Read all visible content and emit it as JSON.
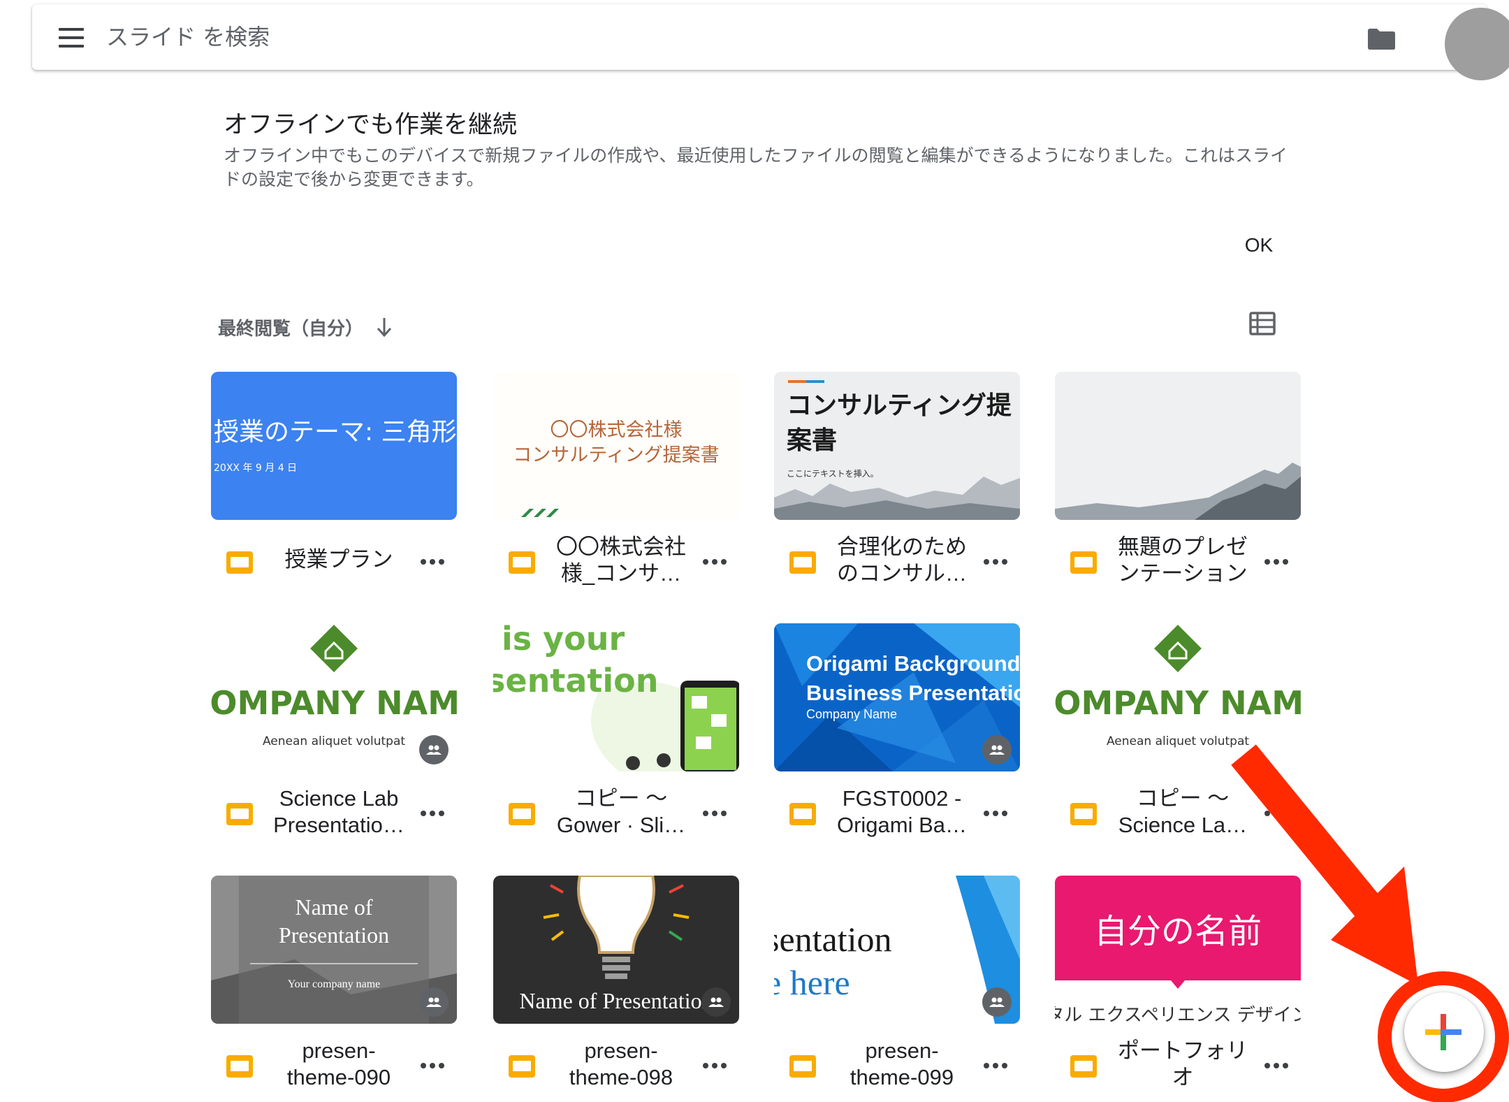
{
  "search": {
    "placeholder": "スライド を検索"
  },
  "banner": {
    "title": "オフラインでも作業を継続",
    "description": "オフライン中でもこのデバイスで新規ファイルの作成や、最近使用したファイルの閲覧と編集ができるようになりました。これはスライドの設定で後から変更できます。",
    "ok_label": "OK"
  },
  "sort": {
    "label": "最終閲覧（自分）"
  },
  "files": [
    {
      "name": "授業プラン",
      "thumb_text": [
        "授業のテーマ: 三角形",
        "20XX 年 9 月 4 日"
      ]
    },
    {
      "name": "〇〇株式会社\n様_コンサ…",
      "thumb_text": [
        "〇〇株式会社様",
        "コンサルティング提案書"
      ]
    },
    {
      "name": "合理化のため\nのコンサル…",
      "thumb_text": [
        "コンサルティング提",
        "案書",
        "ここにテキストを挿入。"
      ]
    },
    {
      "name": "無題のプレゼ\nンテーション",
      "thumb_text": []
    },
    {
      "name": "Science Lab\nPresentatio…",
      "thumb_text": [
        "COMPANY NAME",
        "Aenean aliquet volutpat"
      ],
      "shared": true
    },
    {
      "name": "コピー ～\nGower · Sli…",
      "thumb_text": [
        "is your",
        "sentation"
      ]
    },
    {
      "name": "FGST0002 -\nOrigami Ba…",
      "thumb_text": [
        "Origami Background",
        "Business Presentation",
        "Company Name"
      ],
      "shared": true
    },
    {
      "name": "コピー ～\nScience La…",
      "thumb_text": [
        "COMPANY NAME",
        "Aenean aliquet volutpat"
      ]
    },
    {
      "name": "presen-\ntheme-090",
      "thumb_text": [
        "Name of",
        "Presentation",
        "Your company name"
      ],
      "shared": true
    },
    {
      "name": "presen-\ntheme-098",
      "thumb_text": [
        "Name of Presentation"
      ],
      "shared": true
    },
    {
      "name": "presen-\ntheme-099",
      "thumb_text": [
        "sentation",
        "e here"
      ],
      "shared": true
    },
    {
      "name": "ポートフォリ\nオ",
      "thumb_text": [
        "自分の名前",
        "タル エクスペリエンス デザイン"
      ]
    }
  ],
  "icons": {
    "menu": "hamburger-menu-icon",
    "folder": "folder-icon",
    "sort": "arrow-down-icon",
    "list_view": "list-view-icon",
    "file_type": "google-slides-icon",
    "more": "more-horizontal-icon",
    "shared": "people-icon",
    "create": "plus-icon"
  },
  "colors": {
    "slides_yellow": "#f9ab00",
    "annotation_red": "#ff2a00",
    "plus_blue": "#4285f4",
    "plus_red": "#ea4335",
    "plus_yellow": "#fbbc04",
    "plus_green": "#34a853"
  }
}
